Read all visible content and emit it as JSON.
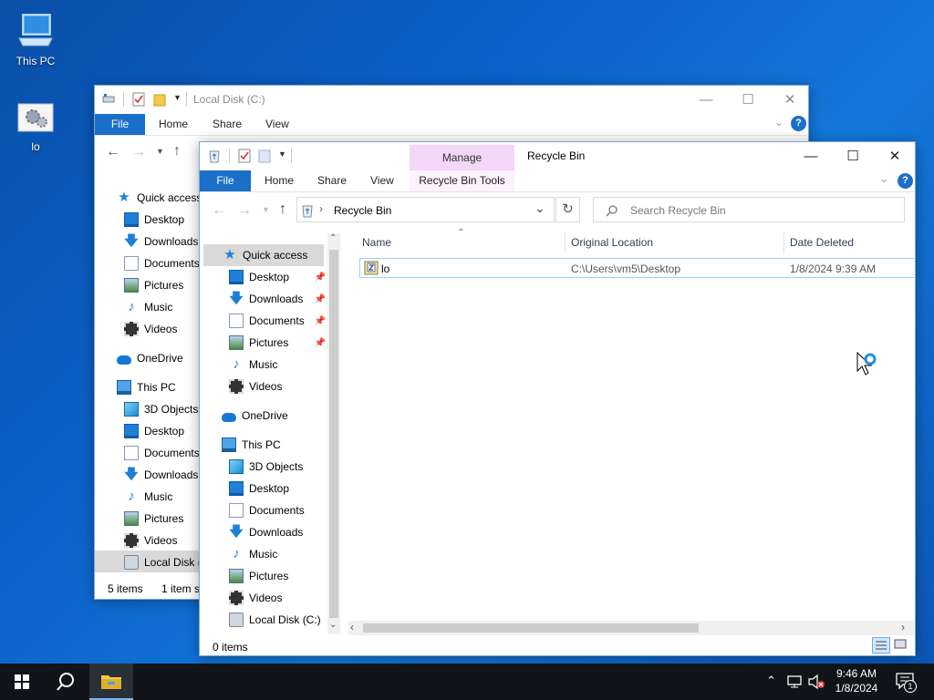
{
  "desktop": {
    "icons": [
      {
        "label": "This PC",
        "icon": "computer-icon"
      },
      {
        "label": "lo",
        "icon": "settings-file-icon"
      }
    ]
  },
  "back_window": {
    "title": "Local Disk (C:)",
    "tabs": [
      "File",
      "Home",
      "Share",
      "View"
    ],
    "nav": [
      {
        "label": "Quick access",
        "icon": "star-icon"
      },
      {
        "label": "Desktop",
        "icon": "desktop-icon"
      },
      {
        "label": "Downloads",
        "icon": "download-icon"
      },
      {
        "label": "Documents",
        "icon": "documents-icon"
      },
      {
        "label": "Pictures",
        "icon": "pictures-icon"
      },
      {
        "label": "Music",
        "icon": "music-icon"
      },
      {
        "label": "Videos",
        "icon": "videos-icon"
      },
      {
        "label": "OneDrive",
        "icon": "cloud-icon"
      },
      {
        "label": "This PC",
        "icon": "computer-icon"
      },
      {
        "label": "3D Objects",
        "icon": "cube-icon"
      },
      {
        "label": "Desktop",
        "icon": "desktop-icon"
      },
      {
        "label": "Documents",
        "icon": "documents-icon"
      },
      {
        "label": "Downloads",
        "icon": "download-icon"
      },
      {
        "label": "Music",
        "icon": "music-icon"
      },
      {
        "label": "Pictures",
        "icon": "pictures-icon"
      },
      {
        "label": "Videos",
        "icon": "videos-icon"
      },
      {
        "label": "Local Disk (",
        "icon": "disk-icon"
      }
    ],
    "status_items": "5 items",
    "status_selected": "1 item s"
  },
  "front_window": {
    "title": "Recycle Bin",
    "manage_label": "Manage",
    "tools_label": "Recycle Bin Tools",
    "tabs": [
      "File",
      "Home",
      "Share",
      "View"
    ],
    "address": "Recycle Bin",
    "search_placeholder": "Search Recycle Bin",
    "nav": [
      {
        "label": "Quick access",
        "icon": "star-icon",
        "pinned": false
      },
      {
        "label": "Desktop",
        "icon": "desktop-icon",
        "pinned": true
      },
      {
        "label": "Downloads",
        "icon": "download-icon",
        "pinned": true
      },
      {
        "label": "Documents",
        "icon": "documents-icon",
        "pinned": true
      },
      {
        "label": "Pictures",
        "icon": "pictures-icon",
        "pinned": true
      },
      {
        "label": "Music",
        "icon": "music-icon",
        "pinned": false
      },
      {
        "label": "Videos",
        "icon": "videos-icon",
        "pinned": false
      },
      {
        "label": "OneDrive",
        "icon": "cloud-icon",
        "pinned": false
      },
      {
        "label": "This PC",
        "icon": "computer-icon",
        "pinned": false
      },
      {
        "label": "3D Objects",
        "icon": "cube-icon",
        "pinned": false
      },
      {
        "label": "Desktop",
        "icon": "desktop-icon",
        "pinned": false
      },
      {
        "label": "Documents",
        "icon": "documents-icon",
        "pinned": false
      },
      {
        "label": "Downloads",
        "icon": "download-icon",
        "pinned": false
      },
      {
        "label": "Music",
        "icon": "music-icon",
        "pinned": false
      },
      {
        "label": "Pictures",
        "icon": "pictures-icon",
        "pinned": false
      },
      {
        "label": "Videos",
        "icon": "videos-icon",
        "pinned": false
      },
      {
        "label": "Local Disk (C:)",
        "icon": "disk-icon",
        "pinned": false
      }
    ],
    "columns": [
      "Name",
      "Original Location",
      "Date Deleted"
    ],
    "files": [
      {
        "name": "lo",
        "location": "C:\\Users\\vm5\\Desktop",
        "deleted": "1/8/2024 9:39 AM"
      }
    ],
    "status": "0 items"
  },
  "taskbar": {
    "time": "9:46 AM",
    "date": "1/8/2024",
    "notification_count": "1"
  },
  "colors": {
    "accent": "#1a6fc9",
    "manage_tab": "#f2d7f7",
    "selection": "#cce8ff"
  }
}
